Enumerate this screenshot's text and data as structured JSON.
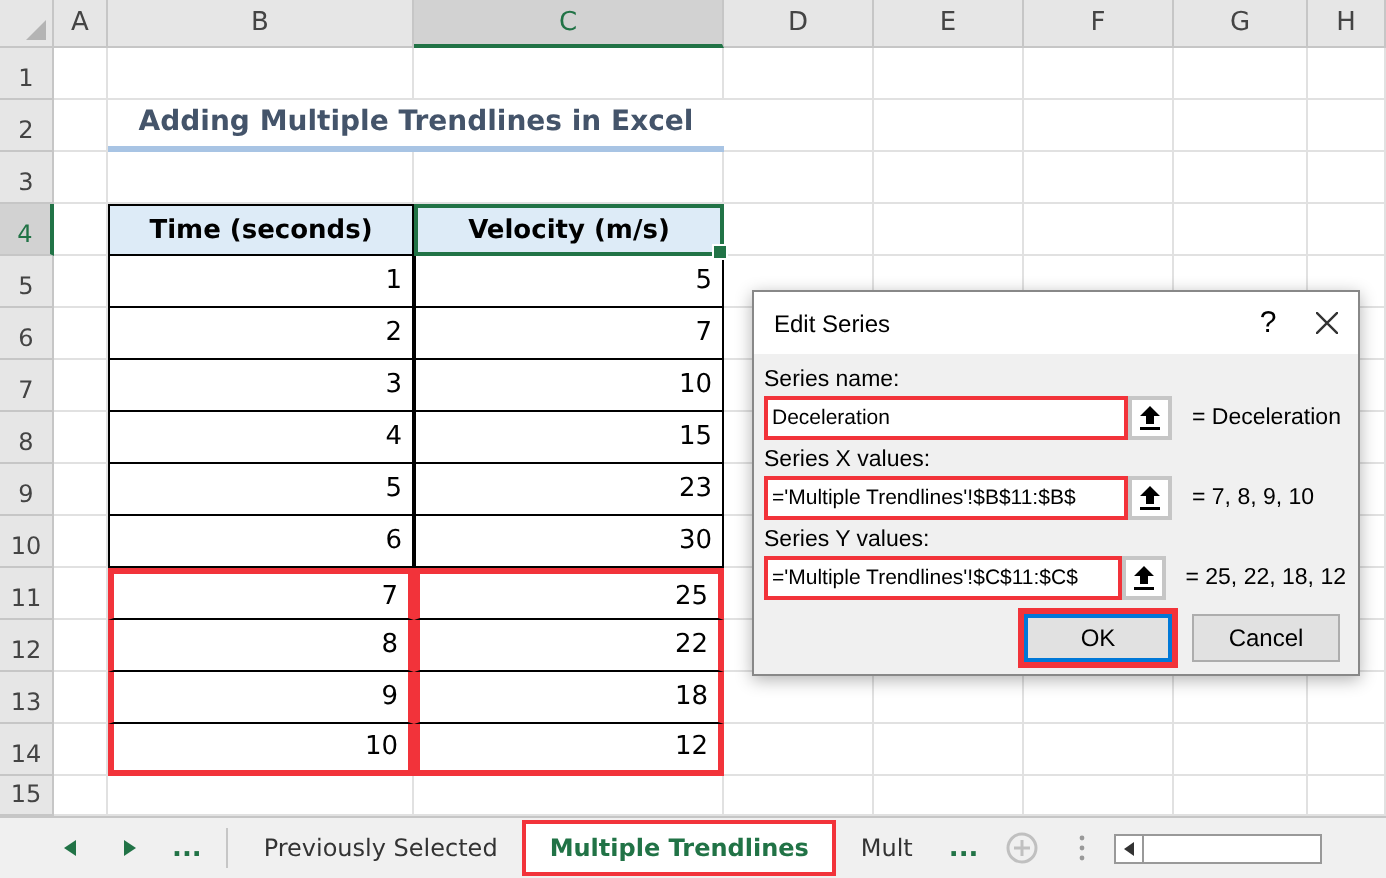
{
  "columns": [
    {
      "label": "A",
      "selected": false
    },
    {
      "label": "B",
      "selected": false
    },
    {
      "label": "C",
      "selected": true
    },
    {
      "label": "D",
      "selected": false
    },
    {
      "label": "E",
      "selected": false
    },
    {
      "label": "F",
      "selected": false
    },
    {
      "label": "G",
      "selected": false
    },
    {
      "label": "H",
      "selected": false
    }
  ],
  "row_numbers": [
    {
      "label": "1",
      "selected": false
    },
    {
      "label": "2",
      "selected": false
    },
    {
      "label": "3",
      "selected": false
    },
    {
      "label": "4",
      "selected": true
    },
    {
      "label": "5",
      "selected": false
    },
    {
      "label": "6",
      "selected": false
    },
    {
      "label": "7",
      "selected": false
    },
    {
      "label": "8",
      "selected": false
    },
    {
      "label": "9",
      "selected": false
    },
    {
      "label": "10",
      "selected": false
    },
    {
      "label": "11",
      "selected": false
    },
    {
      "label": "12",
      "selected": false
    },
    {
      "label": "13",
      "selected": false
    },
    {
      "label": "14",
      "selected": false
    },
    {
      "label": "15",
      "selected": false
    }
  ],
  "title": "Adding Multiple Trendlines in Excel",
  "table": {
    "headers": [
      {
        "text": "Time (seconds)",
        "selected": false
      },
      {
        "text": "Velocity (m/s)",
        "selected": true
      }
    ],
    "rows": [
      {
        "time": "1",
        "velocity": "5",
        "highlighted": false
      },
      {
        "time": "2",
        "velocity": "7",
        "highlighted": false
      },
      {
        "time": "3",
        "velocity": "10",
        "highlighted": false
      },
      {
        "time": "4",
        "velocity": "15",
        "highlighted": false
      },
      {
        "time": "5",
        "velocity": "23",
        "highlighted": false
      },
      {
        "time": "6",
        "velocity": "30",
        "highlighted": false
      },
      {
        "time": "7",
        "velocity": "25",
        "highlighted": true
      },
      {
        "time": "8",
        "velocity": "22",
        "highlighted": true
      },
      {
        "time": "9",
        "velocity": "18",
        "highlighted": true
      },
      {
        "time": "10",
        "velocity": "12",
        "highlighted": true
      }
    ]
  },
  "dialog": {
    "title": "Edit Series",
    "help": "?",
    "fields": [
      {
        "label": "Series name:",
        "value": "Deceleration",
        "result": "= Deceleration",
        "highlighted": true
      },
      {
        "label": "Series X values:",
        "value": "='Multiple Trendlines'!$B$11:$B$",
        "result": "= 7, 8, 9, 10",
        "highlighted": true
      },
      {
        "label": "Series Y values:",
        "value": "='Multiple Trendlines'!$C$11:$C$",
        "result": "= 25, 22, 18, 12",
        "highlighted": true
      }
    ],
    "buttons": [
      {
        "label": "OK",
        "kind": "primary",
        "highlighted": true
      },
      {
        "label": "Cancel",
        "kind": "secondary",
        "highlighted": false
      }
    ]
  },
  "sheet_tabs": {
    "more_left": "...",
    "tabs": [
      {
        "label": "Previously Selected",
        "selected": false,
        "highlighted": false
      },
      {
        "label": "Multiple Trendlines",
        "selected": true,
        "highlighted": true
      },
      {
        "label": "Mult",
        "selected": false,
        "highlighted": false
      }
    ],
    "more_right": "..."
  }
}
